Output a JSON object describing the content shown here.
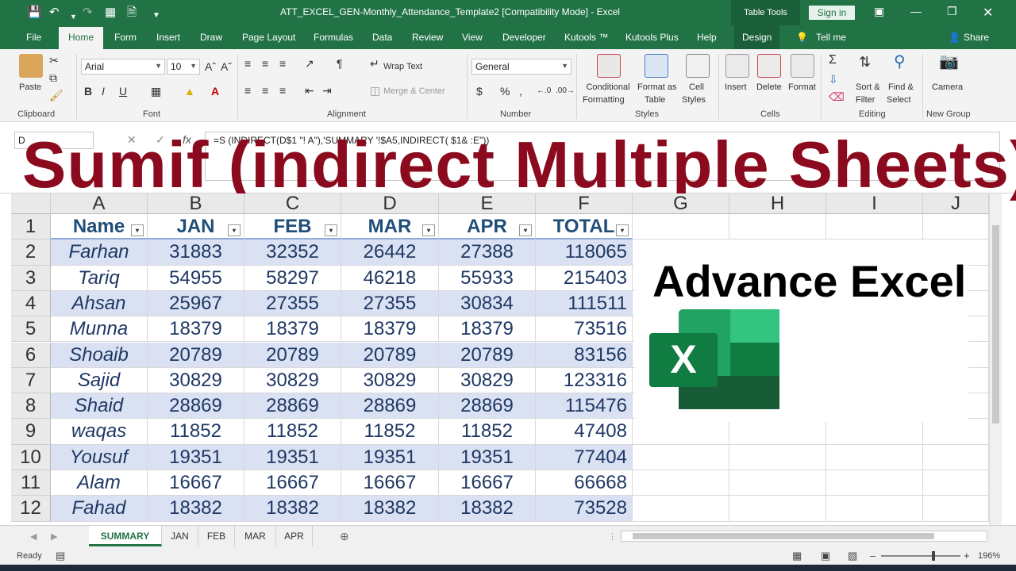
{
  "window": {
    "title": "ATT_EXCEL_GEN-Monthly_Attendance_Template2  [Compatibility Mode]  -  Excel",
    "table_tools": "Table Tools",
    "sign_in": "Sign in"
  },
  "tabs": [
    "File",
    "Home",
    "Form",
    "Insert",
    "Draw",
    "Page Layout",
    "Formulas",
    "Data",
    "Review",
    "View",
    "Developer",
    "Kutools ™",
    "Kutools Plus",
    "Help",
    "Design"
  ],
  "tell_me": "Tell me",
  "share": "Share",
  "ribbon": {
    "paste": "Paste",
    "clipboard": "Clipboard",
    "font_name": "Arial",
    "font_size": "10",
    "font": "Font",
    "wrap_text": "Wrap Text",
    "merge_center": "Merge & Center",
    "alignment": "Alignment",
    "number_format": "General",
    "number": "Number",
    "conditional_formatting": [
      "Conditional",
      "Formatting"
    ],
    "format_as_table": [
      "Format as",
      "Table"
    ],
    "cell_styles": [
      "Cell",
      "Styles"
    ],
    "styles": "Styles",
    "insert": "Insert",
    "delete": "Delete",
    "format": "Format",
    "cells": "Cells",
    "sort_filter": [
      "Sort &",
      "Filter"
    ],
    "find_select": [
      "Find &",
      "Select"
    ],
    "editing": "Editing",
    "camera": "Camera",
    "new_group": "New Group"
  },
  "formula_bar": {
    "name_box": "D",
    "formula": "=S     (INDIRECT(D$1    \"!   A\"),'SUMMARY '!$A5,INDIRECT(    $1&    :E\"))"
  },
  "overlay": {
    "title": "Sumif (indirect Multiple Sheets)",
    "advance": "Advance Excel"
  },
  "columns": [
    "A",
    "B",
    "C",
    "D",
    "E",
    "F",
    "G",
    "H",
    "I",
    "J"
  ],
  "table": {
    "headers": [
      "Name",
      "JAN",
      "FEB",
      "MAR",
      "APR",
      "TOTAL"
    ],
    "rows": [
      [
        "Farhan",
        "31883",
        "32352",
        "26442",
        "27388",
        "118065"
      ],
      [
        "Tariq",
        "54955",
        "58297",
        "46218",
        "55933",
        "215403"
      ],
      [
        "Ahsan",
        "25967",
        "27355",
        "27355",
        "30834",
        "111511"
      ],
      [
        "Munna",
        "18379",
        "18379",
        "18379",
        "18379",
        "73516"
      ],
      [
        "Shoaib",
        "20789",
        "20789",
        "20789",
        "20789",
        "83156"
      ],
      [
        "Sajid",
        "30829",
        "30829",
        "30829",
        "30829",
        "123316"
      ],
      [
        "Shaid",
        "28869",
        "28869",
        "28869",
        "28869",
        "115476"
      ],
      [
        "waqas",
        "11852",
        "11852",
        "11852",
        "11852",
        "47408"
      ],
      [
        "Yousuf",
        "19351",
        "19351",
        "19351",
        "19351",
        "77404"
      ],
      [
        "Alam",
        "16667",
        "16667",
        "16667",
        "16667",
        "66668"
      ],
      [
        "Fahad",
        "18382",
        "18382",
        "18382",
        "18382",
        "73528"
      ]
    ]
  },
  "row_numbers": [
    "1",
    "2",
    "3",
    "4",
    "5",
    "6",
    "7",
    "8",
    "9",
    "10",
    "11",
    "12"
  ],
  "sheets": [
    "SUMMARY",
    "JAN",
    "FEB",
    "MAR",
    "APR"
  ],
  "status": {
    "ready": "Ready",
    "zoom": "196%"
  },
  "colors": {
    "excel_green": "#217346",
    "title_red": "#8b0a1e",
    "band_blue": "#d9e1f2"
  }
}
